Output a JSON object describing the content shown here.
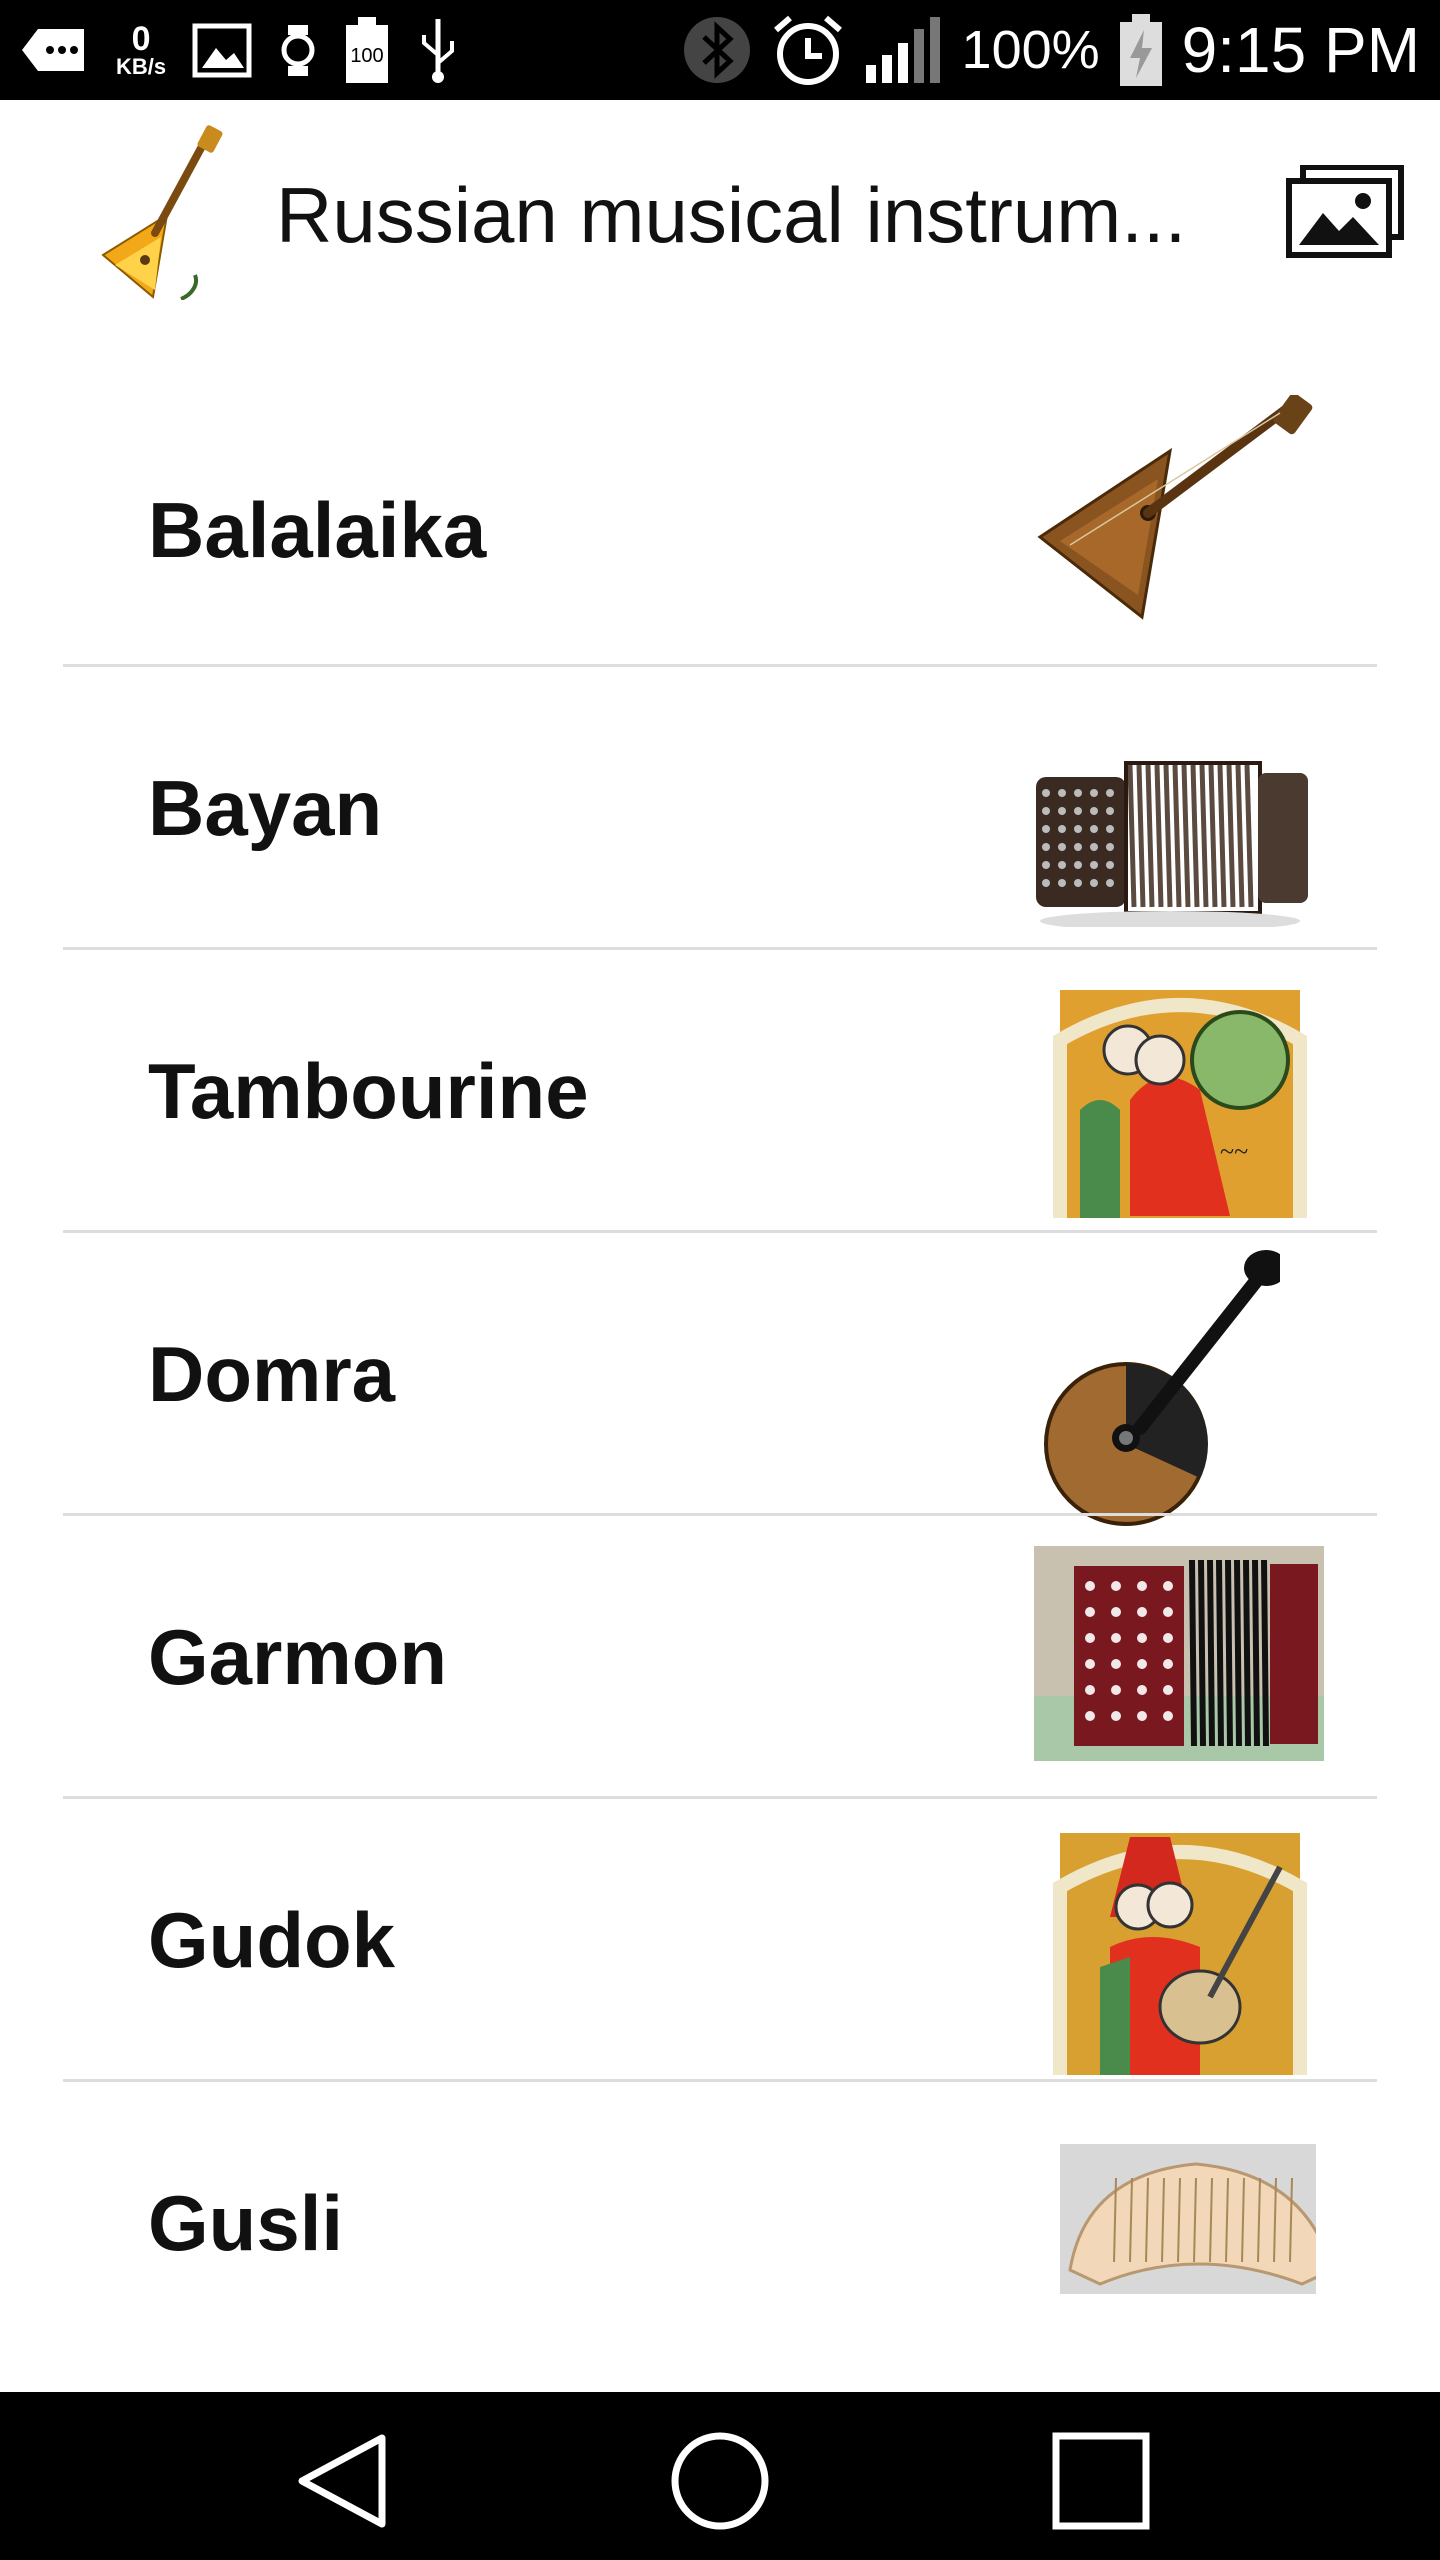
{
  "status_bar": {
    "data_rate_value": "0",
    "data_rate_unit": "KB/s",
    "battery_percent": "100%",
    "time": "9:15 PM",
    "icons": [
      "message-icon",
      "image-icon",
      "watch-icon",
      "battery-saver-icon",
      "usb-icon",
      "bluetooth-icon",
      "alarm-icon",
      "signal-icon",
      "battery-charging-icon"
    ]
  },
  "app_bar": {
    "title": "Russian musical instrum...",
    "app_icon": "balalaika-icon",
    "action_icon": "gallery-icon"
  },
  "instruments": [
    {
      "name": "Balalaika"
    },
    {
      "name": "Bayan"
    },
    {
      "name": "Tambourine"
    },
    {
      "name": "Domra"
    },
    {
      "name": "Garmon"
    },
    {
      "name": "Gudok"
    },
    {
      "name": "Gusli"
    }
  ],
  "nav_bar": {
    "icons": [
      "back-icon",
      "home-icon",
      "recents-icon"
    ]
  },
  "colors": {
    "status_bar_bg": "#000000",
    "nav_bar_bg": "#000000",
    "divider": "#dddddd",
    "text": "#111111"
  }
}
